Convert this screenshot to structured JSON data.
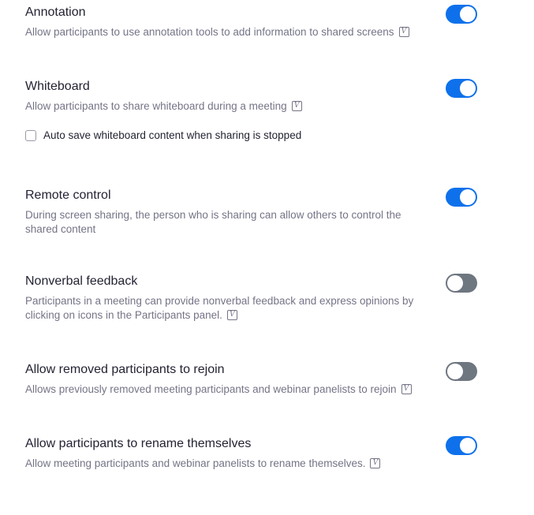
{
  "colors": {
    "toggle_on": "#0e71eb",
    "toggle_off": "#6e7680",
    "title": "#232333",
    "description": "#747487"
  },
  "settings": [
    {
      "title": "Annotation",
      "description": "Allow participants to use annotation tools to add information to shared screens",
      "has_v_icon": true,
      "v_icon_label": "V",
      "enabled": true
    },
    {
      "title": "Whiteboard",
      "description": "Allow participants to share whiteboard during a meeting",
      "has_v_icon": true,
      "v_icon_label": "V",
      "enabled": true,
      "sub_option": {
        "label": "Auto save whiteboard content when sharing is stopped",
        "checked": false
      }
    },
    {
      "title": "Remote control",
      "description": "During screen sharing, the person who is sharing can allow others to control the shared content",
      "has_v_icon": false,
      "enabled": true
    },
    {
      "title": "Nonverbal feedback",
      "description": "Participants in a meeting can provide nonverbal feedback and express opinions by clicking on icons in the Participants panel.",
      "has_v_icon": true,
      "v_icon_label": "V",
      "enabled": false
    },
    {
      "title": "Allow removed participants to rejoin",
      "description": "Allows previously removed meeting participants and webinar panelists to rejoin",
      "has_v_icon": true,
      "v_icon_label": "V",
      "enabled": false
    },
    {
      "title": "Allow participants to rename themselves",
      "description": "Allow meeting participants and webinar panelists to rename themselves.",
      "has_v_icon": true,
      "v_icon_label": "V",
      "enabled": true
    }
  ]
}
